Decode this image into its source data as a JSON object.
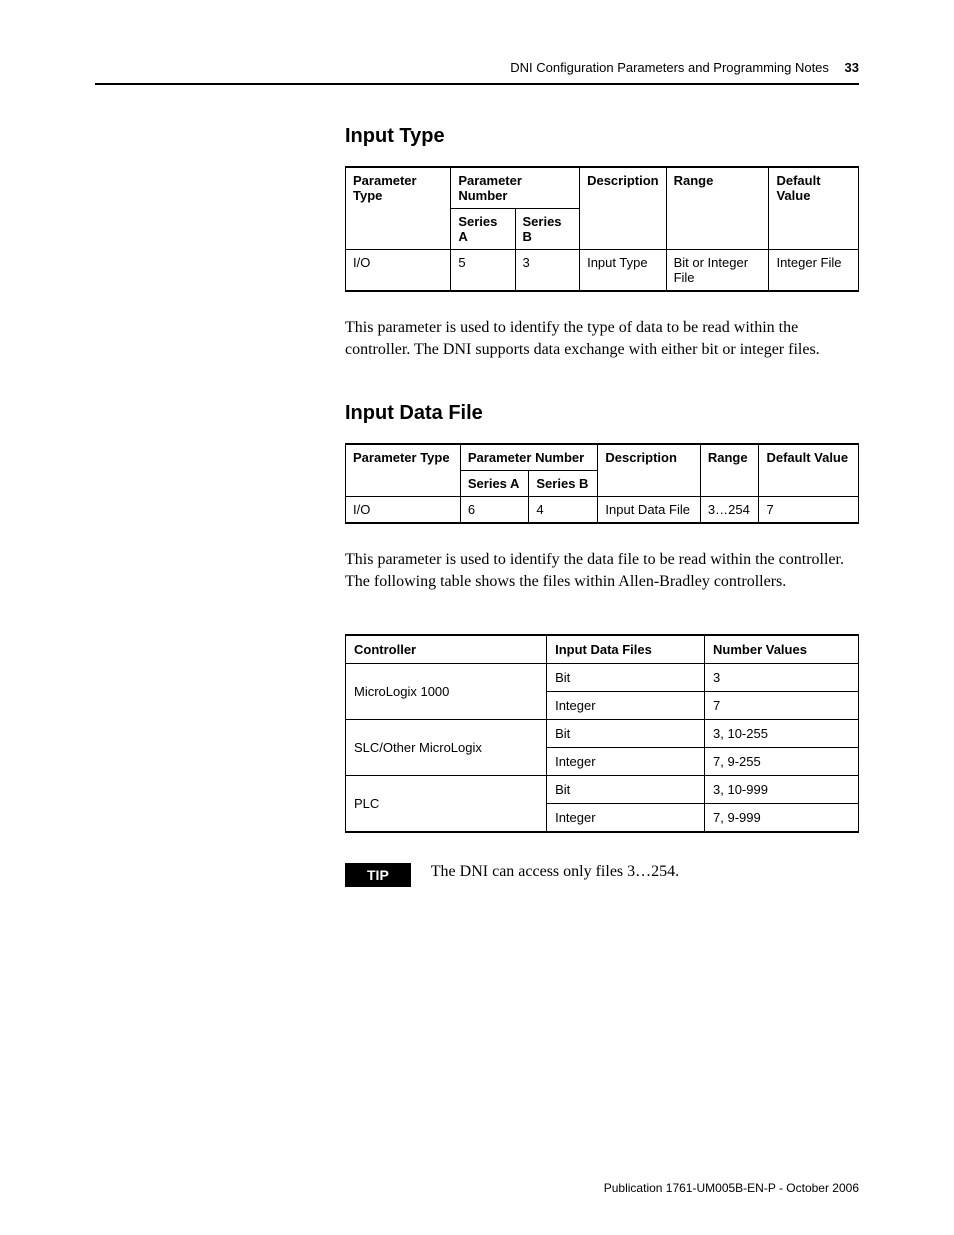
{
  "header": {
    "running_title": "DNI Configuration Parameters and Programming Notes",
    "page_number": "33"
  },
  "section1": {
    "title": "Input Type",
    "table_headers": {
      "param_type": "Parameter Type",
      "param_num": "Parameter Number",
      "series_a": "Series A",
      "series_b": "Series B",
      "description": "Description",
      "range": "Range",
      "default": "Default Value"
    },
    "row": {
      "param_type": "I/O",
      "series_a": "5",
      "series_b": "3",
      "description": "Input Type",
      "range": "Bit or Integer File",
      "default": "Integer File"
    },
    "body": "This parameter is used to identify the type of data to be read within the controller. The DNI supports data exchange with either bit or integer files."
  },
  "section2": {
    "title": "Input Data File",
    "table_headers": {
      "param_type": "Parameter Type",
      "param_num": "Parameter Number",
      "series_a": "Series A",
      "series_b": "Series B",
      "description": "Description",
      "range": "Range",
      "default": "Default Value"
    },
    "row": {
      "param_type": "I/O",
      "series_a": "6",
      "series_b": "4",
      "description": "Input Data File",
      "range": "3…254",
      "default": "7"
    },
    "body": "This parameter is used to identify the data file to be read within the controller. The following table shows the files within Allen-Bradley controllers.",
    "files_headers": {
      "controller": "Controller",
      "input_files": "Input Data Files",
      "number_values": "Number Values"
    },
    "files_rows": [
      {
        "controller": "MicroLogix 1000",
        "input": "Bit",
        "values": "3"
      },
      {
        "controller": "",
        "input": "Integer",
        "values": "7"
      },
      {
        "controller": "SLC/Other MicroLogix",
        "input": "Bit",
        "values": "3, 10-255"
      },
      {
        "controller": "",
        "input": "Integer",
        "values": "7, 9-255"
      },
      {
        "controller": "PLC",
        "input": "Bit",
        "values": "3, 10-999"
      },
      {
        "controller": "",
        "input": "Integer",
        "values": "7, 9-999"
      }
    ],
    "tip_label": "TIP",
    "tip_text": "The DNI can access only files 3…254."
  },
  "footer": {
    "publication": "Publication 1761-UM005B-EN-P - October 2006"
  }
}
